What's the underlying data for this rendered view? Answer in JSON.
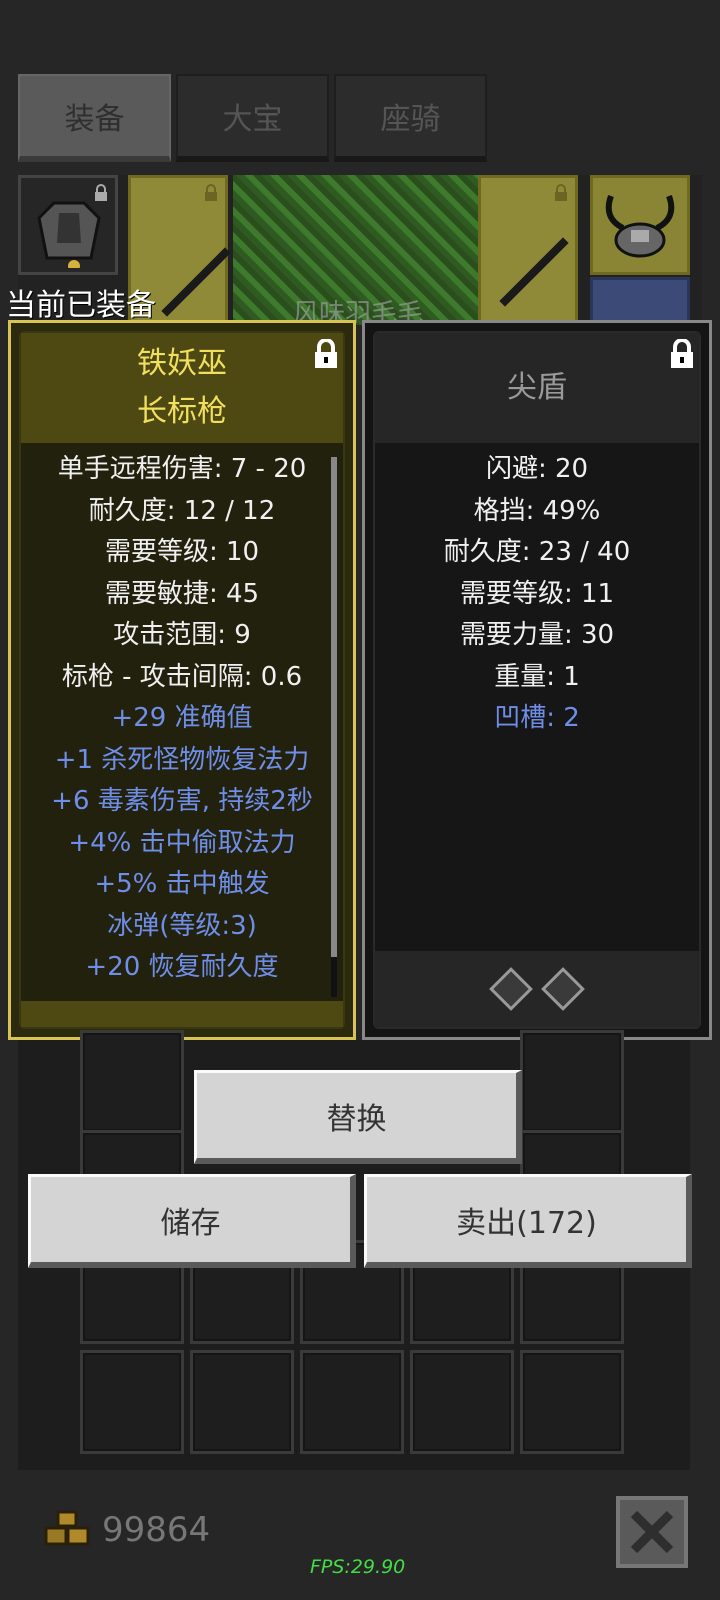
{
  "tabs": [
    {
      "label": "装备",
      "active": true
    },
    {
      "label": "大宝",
      "active": false
    },
    {
      "label": "座骑",
      "active": false
    }
  ],
  "equipment_strip": {
    "background_word": "风味羽毛毛"
  },
  "equipped_label": "当前已装备",
  "left_item": {
    "title_line1": "铁妖巫",
    "title_line2": "长标枪",
    "stats": [
      "单手远程伤害: 7 - 20",
      "耐久度: 12 / 12",
      "需要等级: 10",
      "需要敏捷: 45",
      "攻击范围: 9",
      "标枪 - 攻击间隔: 0.6"
    ],
    "magic_stats": [
      "+29 准确值",
      "+1 杀死怪物恢复法力",
      "+6 毒素伤害, 持续2秒",
      "+4% 击中偷取法力",
      "+5% 击中触发",
      "冰弹(等级:3)",
      "+20 恢复耐久度"
    ]
  },
  "right_item": {
    "title": "尖盾",
    "stats": [
      "闪避: 20",
      "格挡: 49%",
      "耐久度: 23 / 40",
      "需要等级: 11",
      "需要力量: 30",
      "重量: 1"
    ],
    "magic_stats": [
      "凹槽: 2"
    ],
    "sockets": 2
  },
  "buttons": {
    "replace": "替换",
    "store": "储存",
    "sell": "卖出(172)"
  },
  "gold": "99864",
  "fps": "FPS:29.90",
  "colors": {
    "magic_blue": "#6f8ee8",
    "unique_gold": "#f1df5e",
    "fps_green": "#44dd44"
  }
}
